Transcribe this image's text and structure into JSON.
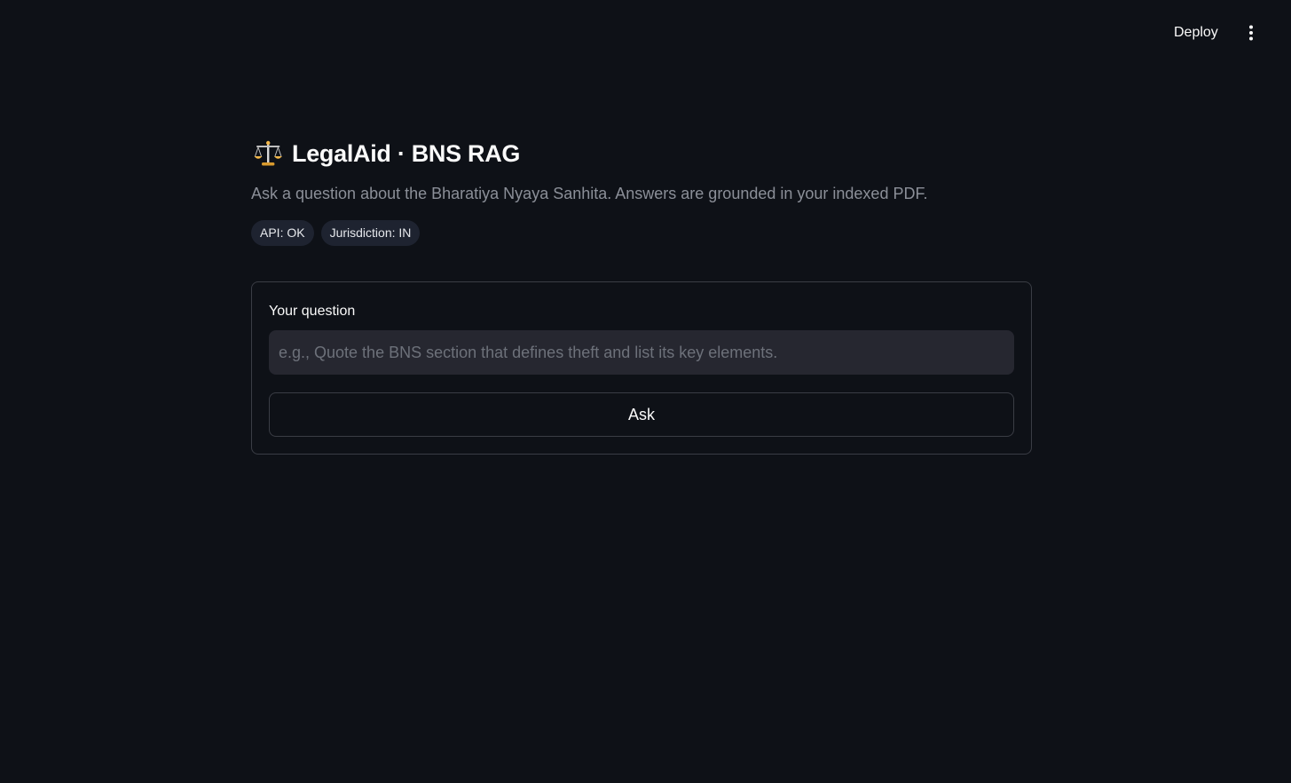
{
  "header": {
    "deploy_label": "Deploy",
    "menu_icon": "vertical-ellipsis-icon"
  },
  "main": {
    "title_icon": "balance-scale-icon",
    "title": "LegalAid · BNS RAG",
    "subtitle": "Ask a question about the Bharatiya Nyaya Sanhita. Answers are grounded in your indexed PDF.",
    "badges": [
      "API: OK",
      "Jurisdiction: IN"
    ],
    "form": {
      "label": "Your question",
      "input_value": "",
      "input_placeholder": "e.g., Quote the BNS section that defines theft and list its key elements.",
      "ask_label": "Ask"
    }
  },
  "colors": {
    "background": "#0e1117",
    "text": "#fafafa",
    "muted": "#8b8f98",
    "badge_bg": "#1e2330",
    "input_bg": "#262730",
    "border": "#3a3d45"
  }
}
